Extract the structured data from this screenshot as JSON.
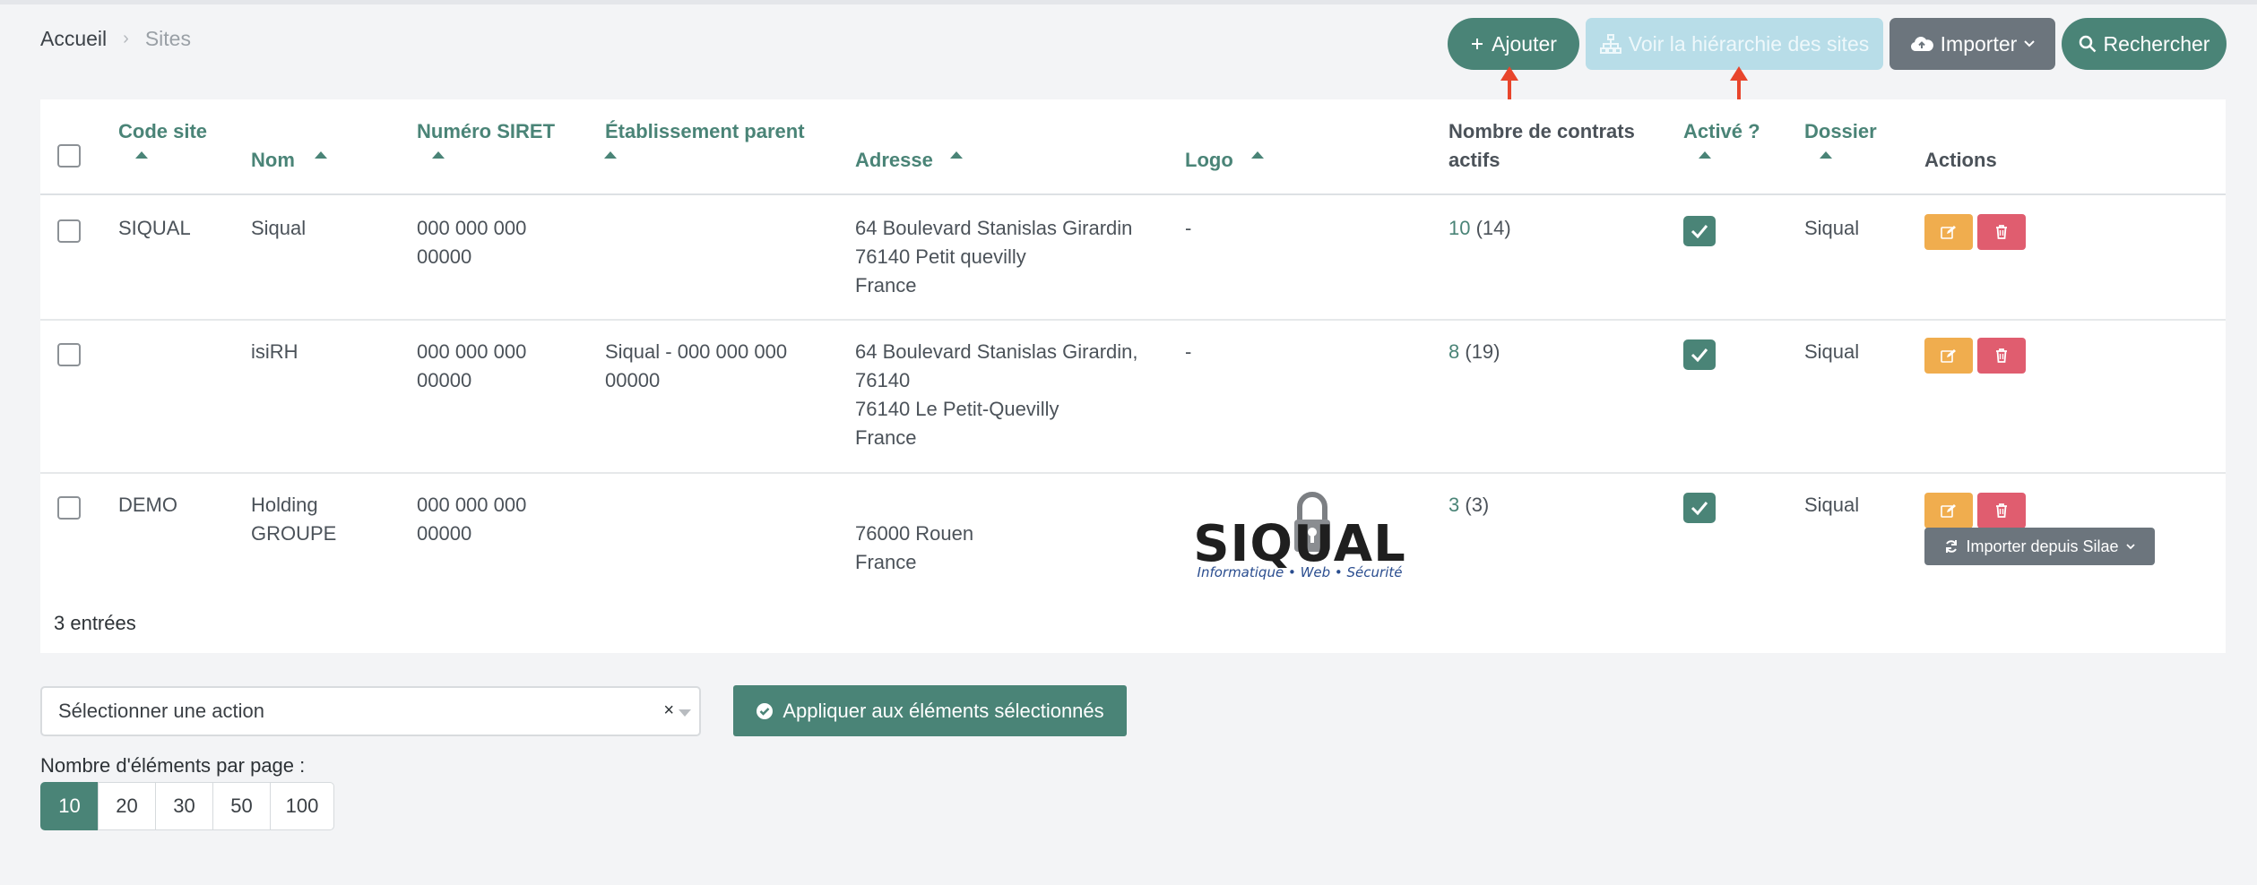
{
  "breadcrumb": {
    "home": "Accueil",
    "separator": "›",
    "current": "Sites"
  },
  "toolbar": {
    "add": "Ajouter",
    "hierarchy": "Voir la hiérarchie des sites",
    "import": "Importer",
    "search": "Rechercher"
  },
  "table": {
    "headers": {
      "code": "Code site",
      "nom": "Nom",
      "siret": "Numéro SIRET",
      "parent": "Établissement parent",
      "adresse": "Adresse",
      "logo": "Logo",
      "contrats_1": "Nombre de contrats",
      "contrats_2": "actifs",
      "active": "Activé ?",
      "dossier": "Dossier",
      "actions": "Actions"
    },
    "rows": [
      {
        "code": "SIQUAL",
        "nom_1": "Siqual",
        "nom_2": "",
        "siret_1": "000 000 000",
        "siret_2": "00000",
        "parent_1": "",
        "parent_2": "",
        "adresse": [
          "64 Boulevard Stanislas Girardin",
          "76140 Petit quevilly",
          "France",
          ""
        ],
        "logo": "-",
        "contrats_actifs": "10",
        "contrats_total": "(14)",
        "dossier": "Siqual"
      },
      {
        "code": "",
        "nom_1": "isiRH",
        "nom_2": "",
        "siret_1": "000 000 000",
        "siret_2": "00000",
        "parent_1": "Siqual - 000 000 000",
        "parent_2": "00000",
        "adresse": [
          "64 Boulevard Stanislas Girardin,",
          "76140",
          "76140 Le Petit-Quevilly",
          "France"
        ],
        "logo": "-",
        "contrats_actifs": "8",
        "contrats_total": "(19)",
        "dossier": "Siqual"
      },
      {
        "code": "DEMO",
        "nom_1": "Holding",
        "nom_2": "GROUPE",
        "siret_1": "000 000 000",
        "siret_2": "00000",
        "parent_1": "",
        "parent_2": "",
        "adresse": [
          "",
          "76000 Rouen",
          "France",
          ""
        ],
        "logo": "",
        "contrats_actifs": "3",
        "contrats_total": "(3)",
        "dossier": "Siqual"
      }
    ],
    "import_silae": "Importer depuis Silae",
    "entries": "3 entrées"
  },
  "logo": {
    "word": "SIQUAL",
    "tagline": "Informatique • Web • Sécurité"
  },
  "bulk": {
    "placeholder": "Sélectionner une action",
    "clear": "×",
    "apply": "Appliquer aux éléments sélectionnés"
  },
  "pagination": {
    "label": "Nombre d'éléments par page :",
    "options": [
      "10",
      "20",
      "30",
      "50",
      "100"
    ]
  },
  "colors": {
    "primary": "#4a8477",
    "warning": "#f0ad4e",
    "danger": "#e05d6f",
    "secondary": "#6c757d",
    "annotation": "#e8452c"
  }
}
